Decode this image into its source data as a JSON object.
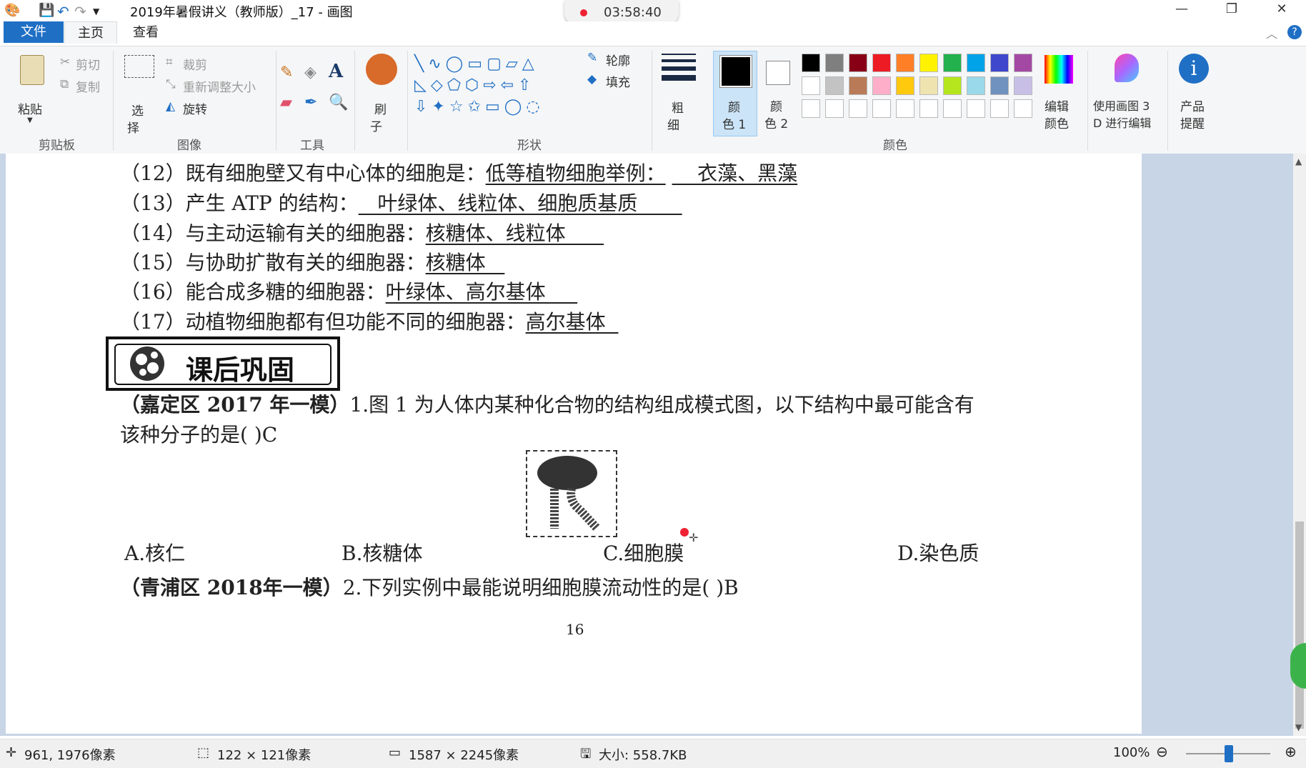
{
  "window": {
    "title": "2019年暑假讲义（教师版）_17 - 画图",
    "recording_time": "03:58:40",
    "minimize": "—",
    "restore": "❐",
    "close": "✕"
  },
  "menu": {
    "file": "文件",
    "home": "主页",
    "view": "查看",
    "help": "?"
  },
  "ribbon": {
    "clipboard": {
      "paste": "粘贴",
      "cut": "剪切",
      "copy": "复制",
      "label": "剪贴板"
    },
    "image": {
      "select_1": "选",
      "select_2": "择",
      "crop": "裁剪",
      "resize": "重新调整大小",
      "rotate": "旋转",
      "label": "图像"
    },
    "tools": {
      "label": "工具",
      "text_tool": "A"
    },
    "brush": {
      "line1": "刷",
      "line2": "子"
    },
    "shapes": {
      "label": "形状",
      "outline": "轮廓",
      "fill": "填充"
    },
    "size": {
      "line1": "粗",
      "line2": "细"
    },
    "color1": {
      "line1": "颜",
      "line2": "色 1"
    },
    "color2": {
      "line1": "颜",
      "line2": "色 2"
    },
    "colors": {
      "label": "颜色",
      "edit_1": "编辑",
      "edit_2": "颜色"
    },
    "paint3d": {
      "line1": "使用画图 3",
      "line2": "D 进行编辑"
    },
    "alert": {
      "line1": "产品",
      "line2": "提醒"
    },
    "palette_row1": [
      "#000000",
      "#7f7f7f",
      "#880015",
      "#ed1c24",
      "#ff7f27",
      "#fff200",
      "#22b14c",
      "#00a2e8",
      "#3f48cc",
      "#a349a4"
    ],
    "palette_row2": [
      "#ffffff",
      "#c3c3c3",
      "#b97a57",
      "#ffaec9",
      "#ffc90e",
      "#efe4b0",
      "#b5e61d",
      "#99d9ea",
      "#7092be",
      "#c8bfe7"
    ],
    "accent_color": "#1f6fc5",
    "record_color": "#ee2233"
  },
  "document": {
    "lines": [
      {
        "prefix": "（12）既有细胞壁又有中心体的细胞是：",
        "answer": "低等植物细胞举例：",
        "answer2": "    衣藻、黑藻"
      },
      {
        "prefix": "（13）产生 ATP 的结构：",
        "answer": "   叶绿体、线粒体、细胞质基质       "
      },
      {
        "prefix": "（14）与主动运输有关的细胞器：",
        "answer": "核糖体、线粒体      "
      },
      {
        "prefix": "（15）与协助扩散有关的细胞器：",
        "answer": "核糖体   "
      },
      {
        "prefix": "（16）能合成多糖的细胞器：",
        "answer": "叶绿体、高尔基体     "
      },
      {
        "prefix": "（17）动植物细胞都有但功能不同的细胞器：",
        "answer": "高尔基体  "
      }
    ],
    "section_badge": "课后巩固",
    "q1": {
      "source": "（嘉定区 2017 年一模）",
      "text1": "1.图 1 为人体内某种化合物的结构组成模式图，以下结构中最可能含有",
      "text2": "该种分子的是(        )C"
    },
    "options": [
      "A.核仁",
      "B.核糖体",
      "C.细胞膜",
      "D.染色质"
    ],
    "q2": {
      "source": "（青浦区  2018年一模）",
      "text": "2.下列实例中最能说明细胞膜流动性的是(        )B"
    },
    "page_number": "16"
  },
  "status": {
    "cursor_pos": "961, 1976像素",
    "selection_size": "122 × 121像素",
    "image_size": "1587 × 2245像素",
    "file_size": "大小: 558.7KB",
    "zoom": "100%"
  }
}
